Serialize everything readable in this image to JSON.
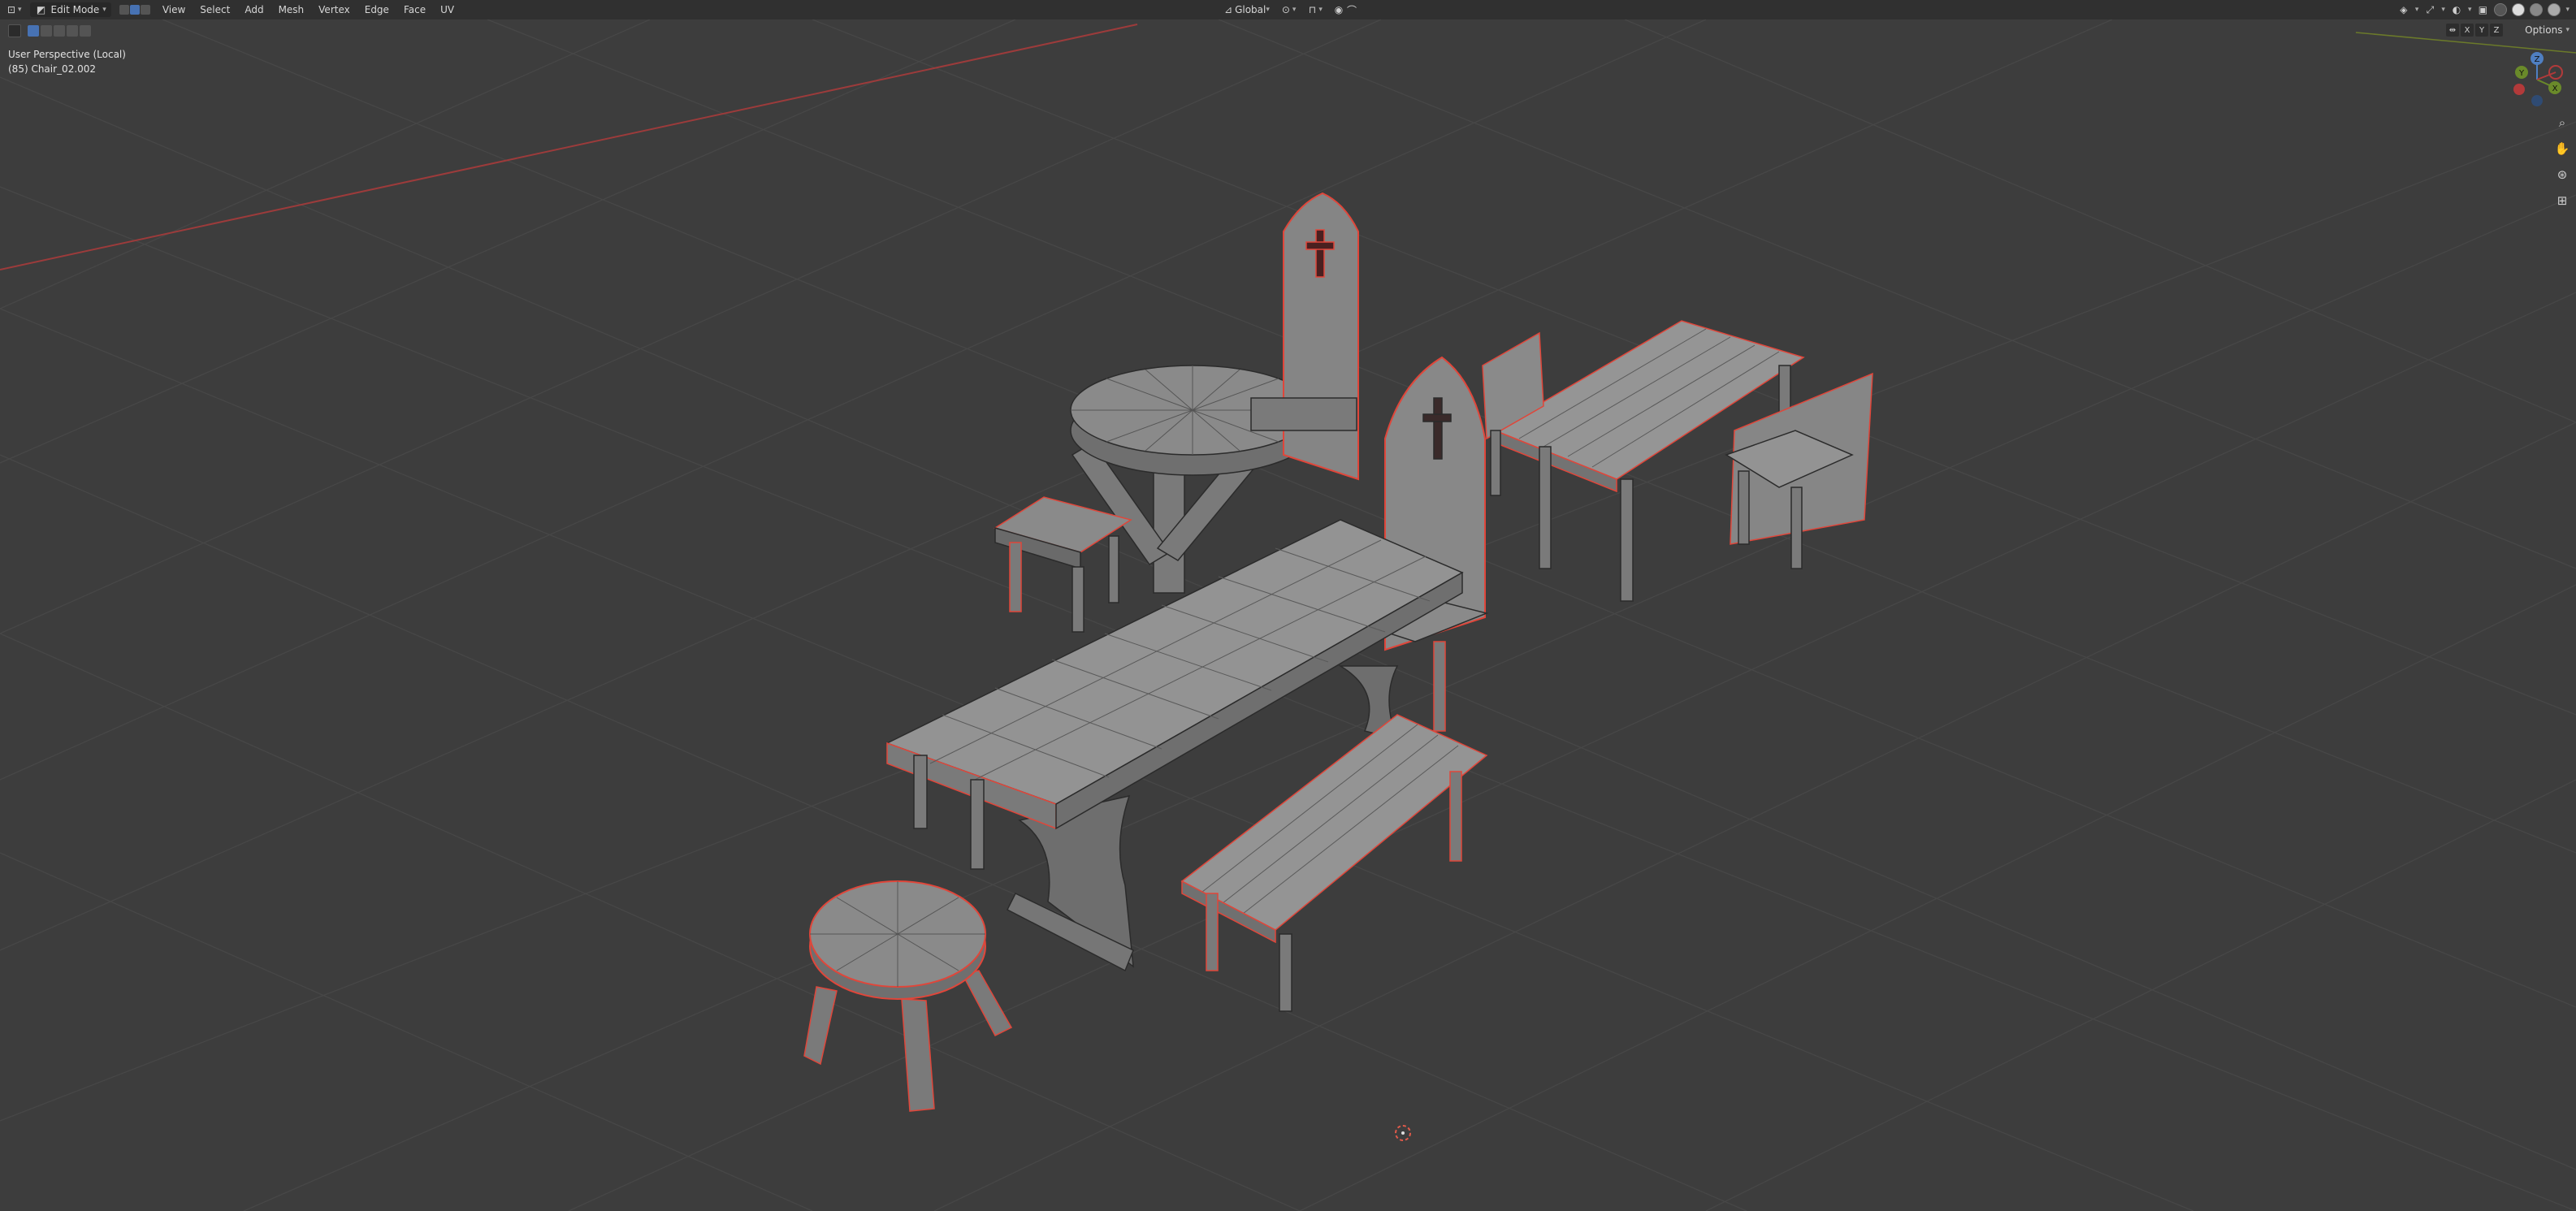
{
  "header": {
    "editor_type_icon": "cube-editor-icon",
    "mode_label": "Edit Mode",
    "menus": [
      "View",
      "Select",
      "Add",
      "Mesh",
      "Vertex",
      "Edge",
      "Face",
      "UV"
    ],
    "transform_orientation": "Global"
  },
  "viewport": {
    "perspective_label": "User Perspective (Local)",
    "object_label": "(85) Chair_02.002"
  },
  "gizmo": {
    "z": "Z",
    "y": "Y",
    "x": "X"
  },
  "axis_toggles": [
    "X",
    "Y",
    "Z"
  ],
  "options_label": "Options",
  "colors": {
    "background": "#3d3d3d",
    "header": "#303030",
    "grid": "#4a4a4a",
    "x_axis": "#9c3b3b",
    "y_axis": "#6b7a2a",
    "mesh_face": "#7a7a7a",
    "mesh_edge": "#2b2b2b",
    "seam": "#e0463a",
    "active": "#4772b3"
  }
}
